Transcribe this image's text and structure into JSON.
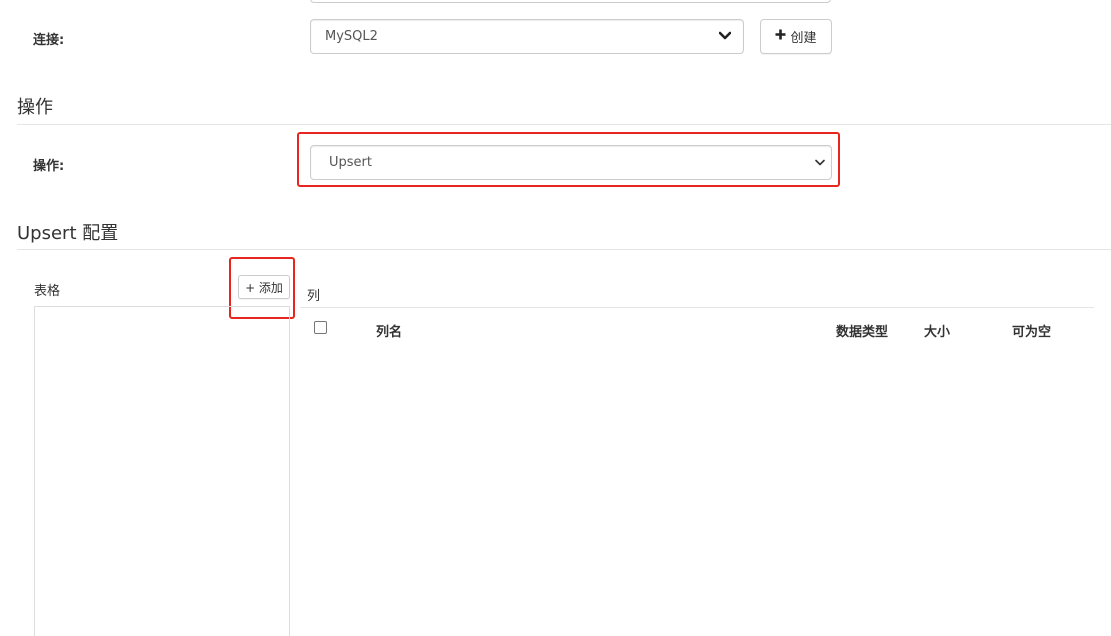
{
  "connection": {
    "label": "连接:",
    "selected": "MySQL2",
    "create_button_label": "创建",
    "create_icon": "plus-icon",
    "caret_icon": "chevron-down-icon"
  },
  "operation_section": {
    "title": "操作",
    "label": "操作:",
    "selected": "Upsert",
    "caret_icon": "chevron-down-icon"
  },
  "upsert_section": {
    "title": "Upsert 配置",
    "tables_label": "表格",
    "add_button_label": "+ 添加",
    "columns_label": "列",
    "columns_headers": [
      "列名",
      "数据类型",
      "大小",
      "可为空"
    ]
  },
  "colors": {
    "highlight": "#e8261f",
    "border": "#cccccc",
    "divider": "#e5e5e5"
  }
}
